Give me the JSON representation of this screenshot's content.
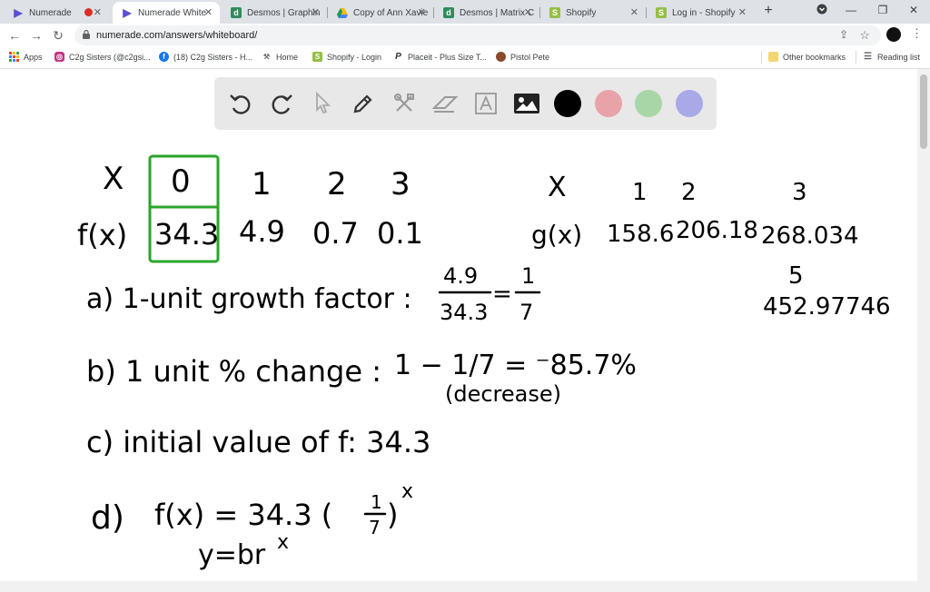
{
  "browser": {
    "tabs": [
      {
        "label": "Numerade",
        "icon": "numerade-icon",
        "active": false
      },
      {
        "label": "Numerade White",
        "icon": "numerade-icon",
        "active": true
      },
      {
        "label": "Desmos | Graphin",
        "icon": "desmos-icon",
        "active": false
      },
      {
        "label": "Copy of Ann Xavie",
        "icon": "google-drive-icon",
        "active": false
      },
      {
        "label": "Desmos | Matrix C",
        "icon": "desmos-icon",
        "active": false
      },
      {
        "label": "Shopify",
        "icon": "shopify-icon",
        "active": false
      },
      {
        "label": "Log in - Shopify",
        "icon": "shopify-icon",
        "active": false
      }
    ],
    "new_tab": "+",
    "url": "numerade.com/answers/whiteboard/",
    "bookmarks": [
      {
        "label": "Apps",
        "icon": "apps-grid-icon"
      },
      {
        "label": "C2g Sisters (@c2gsi...",
        "icon": "instagram-icon"
      },
      {
        "label": "(18) C2g Sisters - H...",
        "icon": "facebook-icon"
      },
      {
        "label": "Home",
        "icon": "tool-icon"
      },
      {
        "label": "Shopify - Login",
        "icon": "shopify-icon"
      },
      {
        "label": "Placeit - Plus Size T...",
        "icon": "placeit-icon"
      },
      {
        "label": "Pistol Pete",
        "icon": "pistol-icon"
      }
    ],
    "other_bookmarks": "Other bookmarks",
    "reading_list": "Reading list"
  },
  "whiteboard": {
    "tools": [
      "undo-icon",
      "redo-icon",
      "select-icon",
      "pen-icon",
      "tools-icon",
      "eraser-icon",
      "text-icon",
      "image-icon"
    ],
    "colors": [
      "#000000",
      "#e8a3a8",
      "#a9d6a6",
      "#a9a9e8"
    ],
    "handwriting": {
      "row_x_label": "X",
      "x_values": [
        "0",
        "1",
        "2",
        "3"
      ],
      "row_f_label": "f(x)",
      "f_values": [
        "34.3",
        "4.9",
        "0.7",
        "0.1"
      ],
      "g_x_label": "X",
      "g_x_values": [
        "1",
        "2",
        "3"
      ],
      "g_label": "g(x)",
      "g_values": [
        "158.6",
        "206.18",
        "268.034"
      ],
      "g_x5": "5",
      "g_x5_value": "452.97746",
      "line_a_left": "a) 1-unit growth factor :",
      "line_a_frac_top": "4.9",
      "line_a_frac_bot": "34.3",
      "line_a_eq": "=",
      "line_a_res_top": "1",
      "line_a_res_bot": "7",
      "line_b_left": "b) 1 unit % change :",
      "line_b_expr": "1 − 1/7 = ⁻85.7%",
      "line_b_note": "(decrease)",
      "line_c": "c) initial value of f: 34.3",
      "line_d_left": "d)",
      "line_d_expr": "f(x) = 34.3 (",
      "line_d_frac_top": "1",
      "line_d_frac_bot": "7",
      "line_d_close": ")",
      "line_d_exp": "x",
      "line_d_general": "y=br",
      "line_d_general_exp": "x"
    }
  }
}
